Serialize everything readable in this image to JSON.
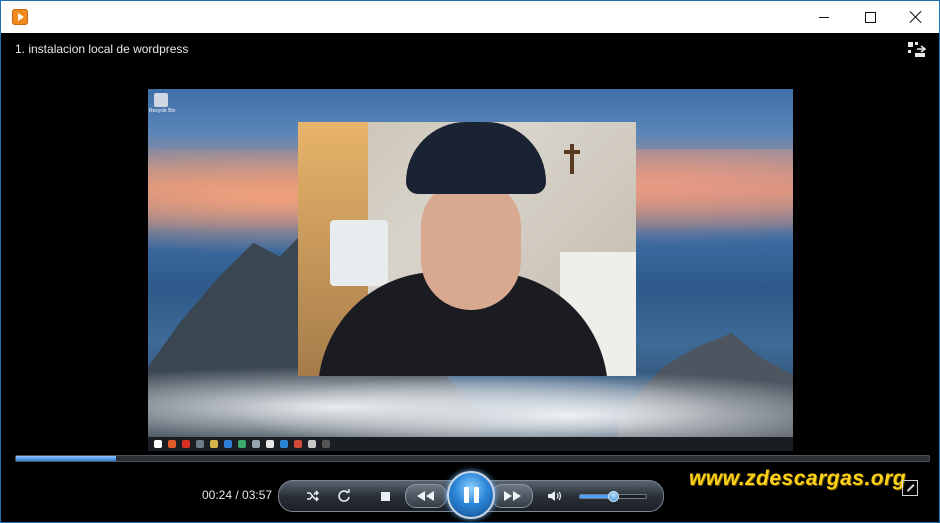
{
  "window": {
    "app_icon": "media-player-icon",
    "controls": {
      "minimize": "minimize-icon",
      "maximize": "maximize-icon",
      "close": "close-icon"
    }
  },
  "now_playing": {
    "title": "1. instalacion local de wordpress",
    "compact_icon": "switch-to-compact-icon"
  },
  "video": {
    "desktop_icon_label": "Recycle Bin"
  },
  "playback": {
    "time_display": "00:24 / 03:57",
    "progress_fraction": 0.11,
    "volume_fraction": 0.5,
    "state": "playing"
  },
  "controls": {
    "shuffle": "shuffle-icon",
    "repeat": "repeat-icon",
    "stop": "stop-icon",
    "previous": "previous-icon",
    "play_pause": "pause-icon",
    "next": "next-icon",
    "mute": "speaker-icon",
    "fullscreen": "expand-icon"
  },
  "watermark": "www.zdescargas.org",
  "colors": {
    "accent": "#2c86d8",
    "watermark": "#ffd21a",
    "window_border": "#1f6fb5"
  }
}
